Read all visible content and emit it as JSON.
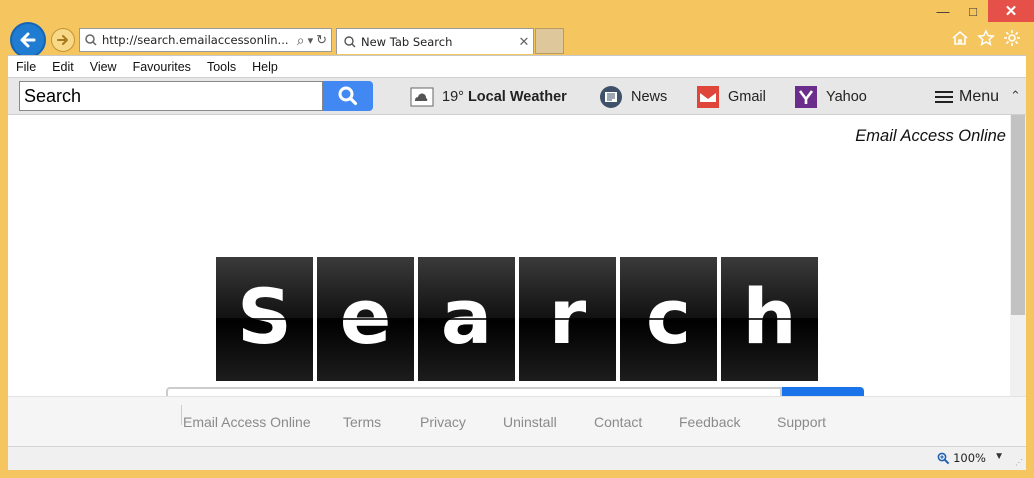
{
  "window": {
    "minimize": "—",
    "maximize": "□",
    "close": "✕"
  },
  "address": {
    "url": "http://search.emailaccessonlin...",
    "search_glyph": "⌕",
    "dropdown_glyph": "▾",
    "refresh_glyph": "↻"
  },
  "tab": {
    "title": "New Tab Search",
    "close": "✕"
  },
  "menubar": {
    "items": [
      "File",
      "Edit",
      "View",
      "Favourites",
      "Tools",
      "Help"
    ]
  },
  "extbar": {
    "search_value": "Search",
    "weather_temp": "19°",
    "weather_label": "Local Weather",
    "news_label": "News",
    "gmail_label": "Gmail",
    "yahoo_label": "Yahoo",
    "menu_label": "Menu",
    "collapse_glyph": "⌃"
  },
  "page": {
    "brand": "Email Access Online",
    "logo_letters": [
      "S",
      "e",
      "a",
      "r",
      "c",
      "h"
    ]
  },
  "footer": {
    "links": [
      "Email Access Online",
      "Terms",
      "Privacy",
      "Uninstall",
      "Contact",
      "Feedback",
      "Support"
    ]
  },
  "status": {
    "zoom": "100%",
    "zoom_arrow": "▼",
    "grip": "⋰"
  },
  "colors": {
    "frame": "#f5c560",
    "search_button": "#4188f3",
    "back_button": "#1f7cd0",
    "gmail": "#e0453a",
    "yahoo": "#6b2d8c"
  }
}
